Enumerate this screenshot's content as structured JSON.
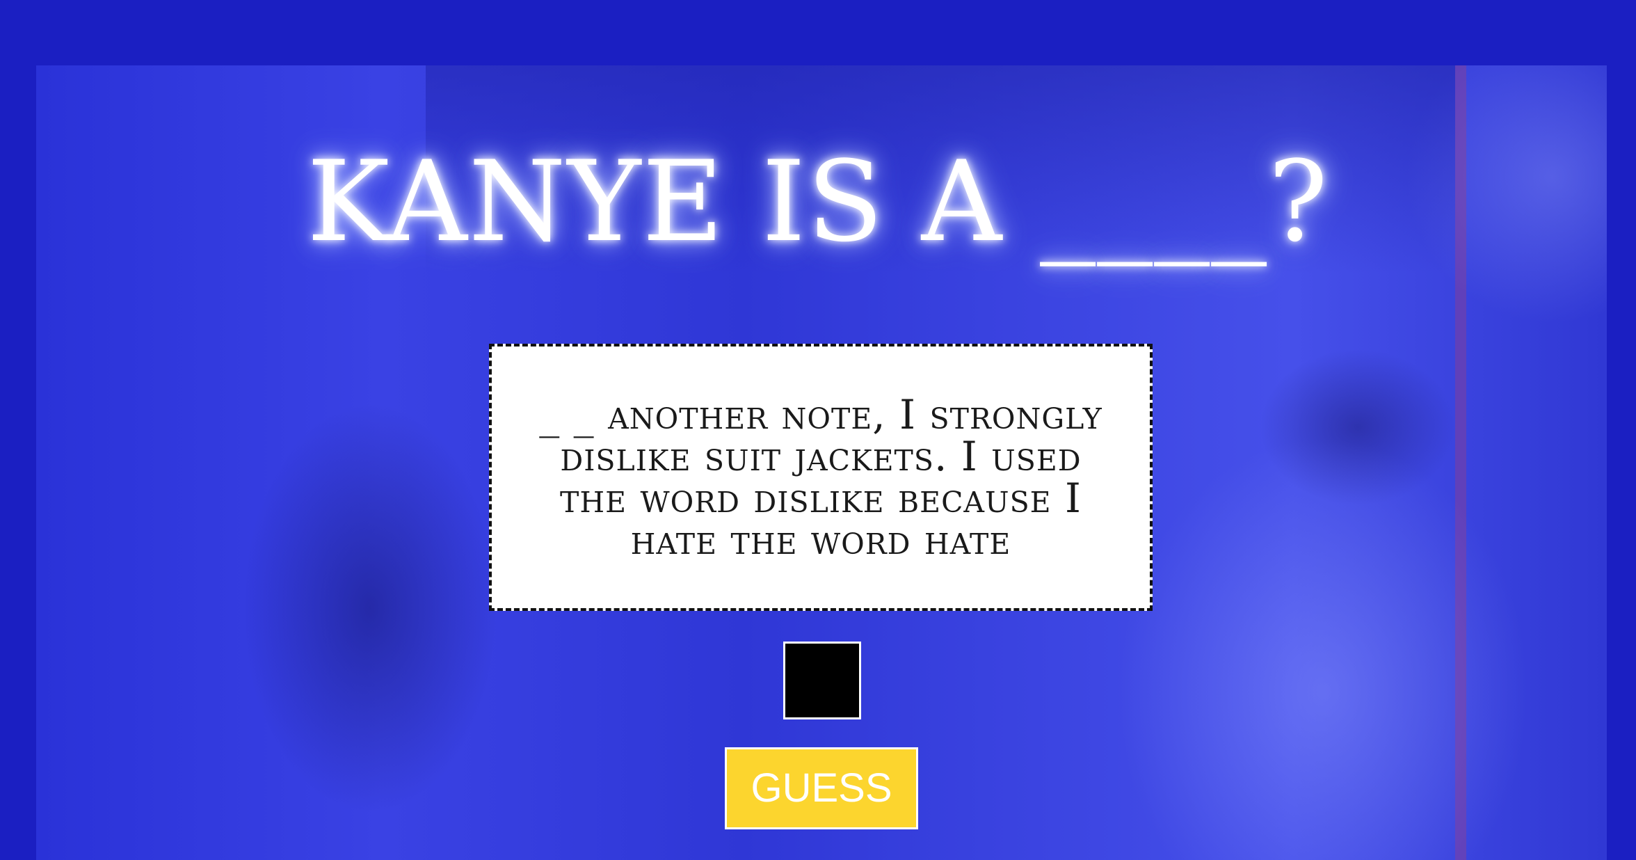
{
  "header": {
    "title": "KANYE IS A ____?"
  },
  "quote": {
    "text": "_ _ another note, I strongly dislike suit jackets. I used the word dislike because I hate the word hate"
  },
  "answer": {
    "value": "",
    "placeholder": ""
  },
  "actions": {
    "guess_label": "GUESS"
  },
  "colors": {
    "page_background": "#1b1fc2",
    "photo_tint": "#3a42e4",
    "button_background": "#fcd52e",
    "input_background": "#000000"
  }
}
